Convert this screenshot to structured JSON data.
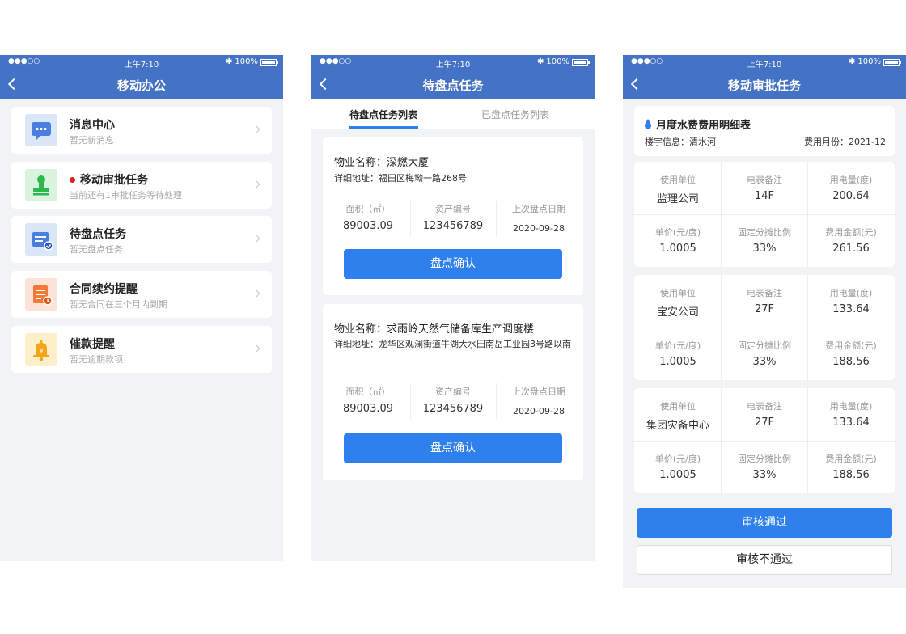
{
  "status_bar": {
    "signal": "●●●○○",
    "time": "上午7:10",
    "battery": "100%"
  },
  "phone1": {
    "title": "移动办公",
    "items": [
      {
        "title": "消息中心",
        "subtitle": "暂无新消息",
        "icon": "message-icon",
        "color": "#4a7fe0"
      },
      {
        "title": "移动审批任务",
        "subtitle": "当前还有1审批任务等待处理",
        "icon": "stamp-icon",
        "color": "#2db84d"
      },
      {
        "title": "待盘点任务",
        "subtitle": "暂无盘点任务",
        "icon": "inventory-icon",
        "color": "#4a7fe0"
      },
      {
        "title": "合同续约提醒",
        "subtitle": "暂无合同在三个月内到期",
        "icon": "contract-icon",
        "color": "#f07a3a"
      },
      {
        "title": "催款提醒",
        "subtitle": "暂无逾期款项",
        "icon": "bell-icon",
        "color": "#f2a516"
      }
    ]
  },
  "phone2": {
    "title": "待盘点任务",
    "tabs": [
      "待盘点任务列表",
      "已盘点任务列表"
    ],
    "col_labels": [
      "面积（㎡）",
      "资产编号",
      "上次盘点日期"
    ],
    "tasks": [
      {
        "name": "物业名称：深燃大厦",
        "address": "详细地址：福田区梅坳一路268号",
        "area": "89003.09",
        "asset_no": "123456789",
        "last_date": "2020-09-28",
        "button": "盘点确认"
      },
      {
        "name": "物业名称：求雨岭天然气储备库生产调度楼",
        "address": "详细地址：龙华区观澜街道牛湖大水田南岳工业园3号路以南",
        "area": "89003.09",
        "asset_no": "123456789",
        "last_date": "2020-09-28",
        "button": "盘点确认"
      }
    ]
  },
  "phone3": {
    "title": "移动审批任务",
    "header": {
      "title": "月度水费费用明细表",
      "building": "楼宇信息：清水河",
      "month": "费用月份：2021-12"
    },
    "labels": [
      "使用单位",
      "电表备注",
      "用电量(度)",
      "单价(元/度)",
      "固定分摊比例",
      "费用金额(元)"
    ],
    "bills": [
      {
        "values": [
          "监理公司",
          "14F",
          "200.64",
          "1.0005",
          "33%",
          "261.56"
        ]
      },
      {
        "values": [
          "宝安公司",
          "27F",
          "133.64",
          "1.0005",
          "33%",
          "188.56"
        ]
      },
      {
        "values": [
          "集团灾备中心",
          "27F",
          "133.64",
          "1.0005",
          "33%",
          "188.56"
        ]
      }
    ],
    "approve": "审核通过",
    "reject": "审核不通过"
  },
  "colors": {
    "primary_bar": "#4472c4",
    "button": "#2f80ed",
    "background": "#f2f3f5"
  }
}
